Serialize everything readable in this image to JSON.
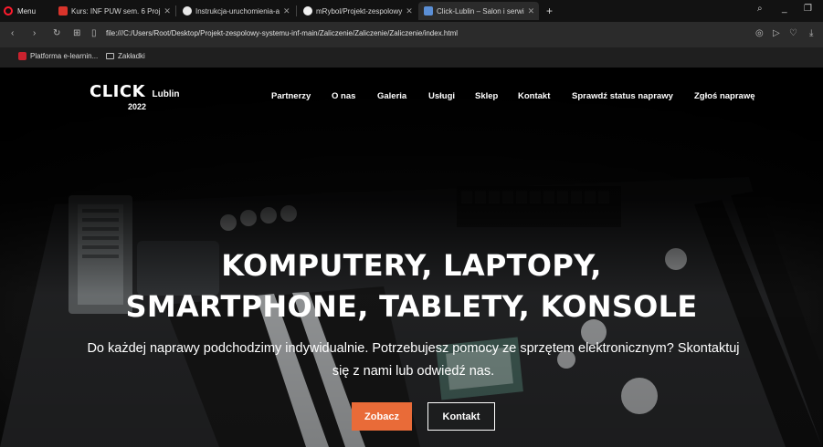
{
  "browser": {
    "menu_label": "Menu",
    "tabs": [
      {
        "title": "Kurs: INF PUW sem. 6 Proj",
        "favicon": "moodle-icon"
      },
      {
        "title": "Instrukcja-uruchomienia-a",
        "favicon": "chrome-icon"
      },
      {
        "title": "mRybol/Projekt-zespolowy",
        "favicon": "github-icon"
      },
      {
        "title": "Click-Lublin – Salon i serwi",
        "favicon": "page-icon",
        "active": true
      }
    ],
    "new_tab_label": "+",
    "address": "file:///C:/Users/Root/Desktop/Projekt-zespolowy-systemu-inf-main/Zaliczenie/Zaliczenie/Zaliczenie/index.html",
    "bookmarks": [
      {
        "label": "Platforma e-learnin...",
        "icon": "moodle-icon"
      },
      {
        "label": "Zakładki",
        "icon": "folder-icon"
      }
    ],
    "colors": {
      "tabbar": "#121212",
      "addressbar": "#2b2b2b",
      "opera_red": "#ff1b2d"
    }
  },
  "site": {
    "logo": {
      "brand": "CLICK",
      "city": "Lublin",
      "year": "2022"
    },
    "nav": [
      "Partnerzy",
      "O nas",
      "Galeria",
      "Usługi",
      "Sklep",
      "Kontakt",
      "Sprawdź status naprawy",
      "Zgłoś naprawę"
    ],
    "hero": {
      "headline_line1": "KOMPUTERY, LAPTOPY,",
      "headline_line2": "SMARTPHONE, TABLETY, KONSOLE",
      "subtext_line1": "Do każdej naprawy podchodzimy indywidualnie. Potrzebujesz pomocy ze sprzętem elektronicznym? Skontaktuj",
      "subtext_line2": "się z nami lub odwiedź nas.",
      "primary_button": "Zobacz",
      "secondary_button": "Kontakt"
    },
    "colors": {
      "accent": "#e96b38",
      "text": "#ffffff"
    }
  }
}
